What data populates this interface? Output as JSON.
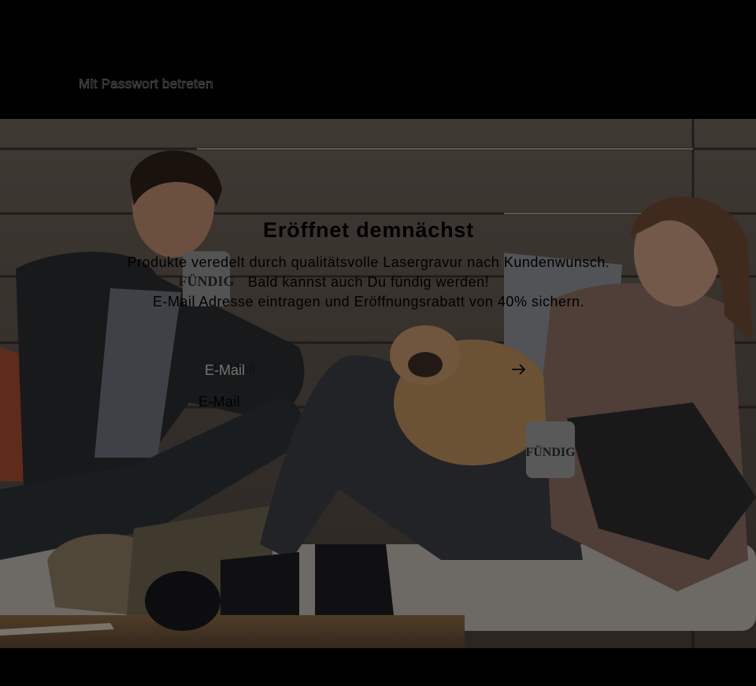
{
  "header": {
    "password_link": "Mit Passwort betreten"
  },
  "hero": {
    "title": "Eröffnet demnächst",
    "description_lines": [
      "Produkte veredelt durch qualitätsvolle Lasergravur nach Kundenwunsch.",
      "Bald kannst auch Du fündig werden!",
      "E-Mail Adresse eintragen und Eröffnungsrabatt von 40% sichern."
    ],
    "mug_text": "FÜNDIG"
  },
  "signup_form": {
    "email_label": "E-Mail",
    "email_placeholder": "E-Mail",
    "email_value": "",
    "submit_icon": "arrow-right-icon",
    "secondary_email_label": "E-Mail"
  },
  "colors": {
    "background": "#000000",
    "text": "#000000"
  }
}
